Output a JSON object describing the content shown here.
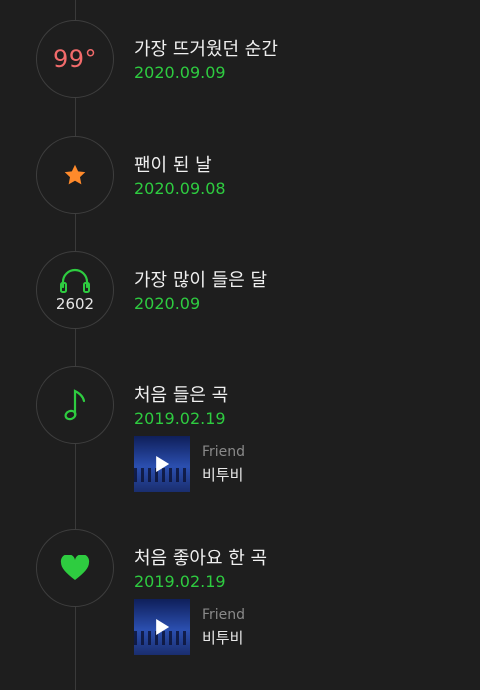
{
  "timeline": [
    {
      "badge": "99°",
      "title": "가장 뜨거웠던 순간",
      "date": "2020.09.09"
    },
    {
      "badge_icon": "star-icon",
      "title": "팬이 된 날",
      "date": "2020.09.08"
    },
    {
      "badge_icon": "headphones-icon",
      "count": "2602",
      "title": "가장 많이 들은 달",
      "date": "2020.09"
    },
    {
      "badge_icon": "music-note-icon",
      "title": "처음 들은 곡",
      "date": "2019.02.19",
      "track": {
        "song": "Friend",
        "artist": "비투비"
      }
    },
    {
      "badge_icon": "heart-icon",
      "title": "처음 좋아요 한 곡",
      "date": "2019.02.19",
      "track": {
        "song": "Friend",
        "artist": "비투비"
      }
    }
  ],
  "colors": {
    "accent": "#2ecc40",
    "temp": "#f26b6b",
    "star": "#ff8a2b",
    "background": "#1e1e1e"
  }
}
